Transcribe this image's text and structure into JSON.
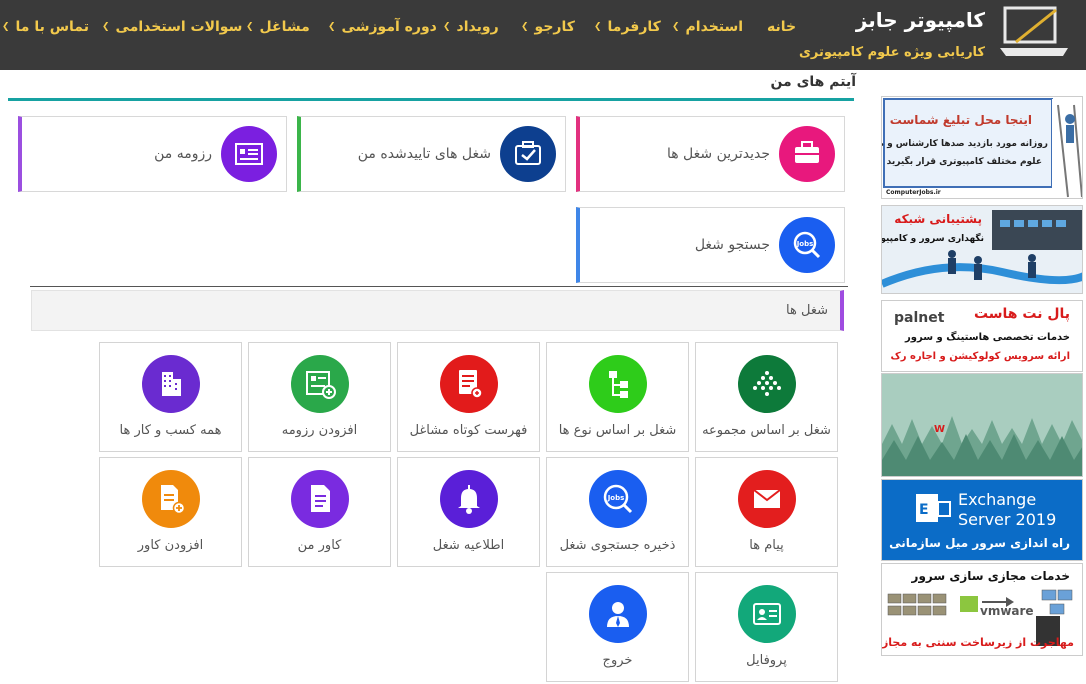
{
  "site": {
    "name": "کامپیوتر جابز",
    "tagline": "کاریابی ویژه علوم کامپیوتری"
  },
  "nav": [
    {
      "label": "خانه",
      "dropdown": false
    },
    {
      "label": "استخدام",
      "dropdown": true
    },
    {
      "label": "کارفرما",
      "dropdown": true
    },
    {
      "label": "کارجو",
      "dropdown": true
    },
    {
      "label": "رویداد",
      "dropdown": true
    },
    {
      "label": "دوره آموزشی",
      "dropdown": true
    },
    {
      "label": "مشاغل",
      "dropdown": true
    },
    {
      "label": "سوالات استخدامی",
      "dropdown": true
    },
    {
      "label": "تماس با ما",
      "dropdown": true
    }
  ],
  "main": {
    "title": "آیتم های من",
    "cards": [
      {
        "label": "جدیدترین شغل ها",
        "icon": "briefcase-icon",
        "color": "#e8187d"
      },
      {
        "label": "شغل های تاییدشده من",
        "icon": "approved-jobs-icon",
        "color": "#0d3f8f"
      },
      {
        "label": "رزومه من",
        "icon": "resume-icon",
        "color": "#7b1fe0"
      },
      {
        "label": "جستجو شغل",
        "icon": "job-search-icon",
        "color": "#1a5ef0"
      }
    ],
    "section_title": "شغل ها",
    "tiles": [
      {
        "label": "شغل بر اساس مجموعه",
        "icon": "job-group-icon",
        "color": "#0d7a3a"
      },
      {
        "label": "شغل بر اساس نوع ها",
        "icon": "job-type-tree-icon",
        "color": "#2ecc1a"
      },
      {
        "label": "فهرست کوتاه مشاغل",
        "icon": "shortlist-icon",
        "color": "#e21b1b"
      },
      {
        "label": "افزودن رزومه",
        "icon": "add-resume-icon",
        "color": "#2aa84a"
      },
      {
        "label": "همه کسب و کار ها",
        "icon": "all-businesses-icon",
        "color": "#6a2bd0"
      },
      {
        "label": "پیام ها",
        "icon": "messages-icon",
        "color": "#e31e1e"
      },
      {
        "label": "ذخیره جستجوی شغل",
        "icon": "saved-search-icon",
        "color": "#1a5ef0"
      },
      {
        "label": "اطلاعیه شغل",
        "icon": "job-alert-bell-icon",
        "color": "#5a1fd8"
      },
      {
        "label": "کاور من",
        "icon": "my-cover-icon",
        "color": "#7a2be0"
      },
      {
        "label": "افزودن کاور",
        "icon": "add-cover-icon",
        "color": "#f08a0c"
      },
      {
        "label": "پروفایل",
        "icon": "profile-icon",
        "color": "#12a87a"
      },
      {
        "label": "خروج",
        "icon": "logout-icon",
        "color": "#1a5ef0"
      }
    ]
  },
  "ads": [
    {
      "title": "اینجا محل تبلیغ شماست",
      "line1": "روزانه مورد بازدید صدها کارشناس و مدیر",
      "line2": "علوم مختلف کامپیوتری قرار بگیرید",
      "footer": "ComputerJobs.ir"
    },
    {
      "title": "پشتیبانی شبکه",
      "line1": "نگهداری سرور و کامپیوتر"
    },
    {
      "brand": "palnet",
      "title": "پال نت هاست",
      "line1": "خدمات تخصصی هاستینگ و سرور",
      "line2": "ارائه سرویس کولوکیشن و اجاره رک"
    },
    {
      "title": ""
    },
    {
      "line1": "Exchange",
      "line2": "Server 2019",
      "line3": "راه اندازی سرور میل سازمانی"
    },
    {
      "title": "خدمات مجازی سازی سرور",
      "brand": "vmware",
      "line1": "مهاجرت از زیرساخت سنتی به مجازی"
    }
  ]
}
